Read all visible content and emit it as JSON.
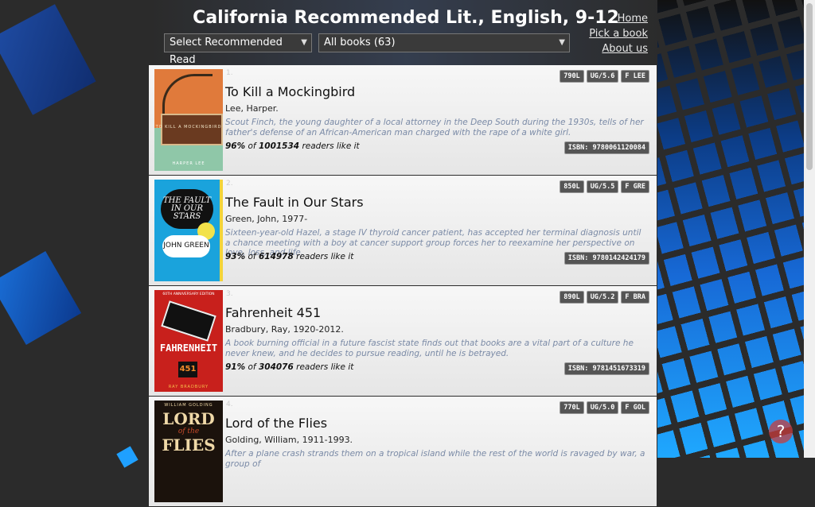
{
  "header": {
    "title": "California Recommended Lit., English, 9-12",
    "select_recommended": "Select Recommended Read",
    "select_books": "All books (63)"
  },
  "nav": {
    "home": "Home",
    "pick": "Pick a book",
    "about": "About us"
  },
  "books": [
    {
      "index": "1.",
      "title": "To Kill a Mockingbird",
      "author": "Lee, Harper.",
      "description": "Scout Finch, the young daughter of a local attorney in the Deep South during the 1930s, tells of her father's defense of an African-American man charged with the rape of a white girl.",
      "percent": "96%",
      "of": "of",
      "readers": "1001534",
      "like": "readers like it",
      "badges": [
        "790L",
        "UG/5.6",
        "F LEE"
      ],
      "isbn": "ISBN: 9780061120084",
      "cover": {
        "title": "TO KILL A MOCKINGBIRD",
        "author": "HARPER LEE"
      }
    },
    {
      "index": "2.",
      "title": "The Fault in Our Stars",
      "author": "Green, John, 1977-",
      "description": "Sixteen-year-old Hazel, a stage IV thyroid cancer patient, has accepted her terminal diagnosis until a chance meeting with a boy at cancer support group forces her to reexamine her perspective on love, loss, and life.",
      "percent": "93%",
      "of": "of",
      "readers": "614978",
      "like": "readers like it",
      "badges": [
        "850L",
        "UG/5.5",
        "F GRE"
      ],
      "isbn": "ISBN: 9780142424179",
      "cover": {
        "title": "THE FAULT IN OUR STARS",
        "author": "JOHN GREEN"
      }
    },
    {
      "index": "3.",
      "title": "Fahrenheit 451",
      "author": "Bradbury, Ray, 1920-2012.",
      "description": "A book burning official in a future fascist state finds out that books are a vital part of a culture he never knew, and he decides to pursue reading, until he is betrayed.",
      "percent": "91%",
      "of": "of",
      "readers": "304076",
      "like": "readers like it",
      "badges": [
        "890L",
        "UG/5.2",
        "F BRA"
      ],
      "isbn": "ISBN: 9781451673319",
      "cover": {
        "edition": "60TH ANNIVERSARY EDITION",
        "title": "FAHRENHEIT",
        "number": "451",
        "author": "RAY BRADBURY"
      }
    },
    {
      "index": "4.",
      "title": "Lord of the Flies",
      "author": "Golding, William, 1911-1993.",
      "description": "After a plane crash strands them on a tropical island while the rest of the world is ravaged by war, a group of",
      "badges": [
        "770L",
        "UG/5.0",
        "F GOL"
      ],
      "cover": {
        "author": "WILLIAM GOLDING",
        "title1": "LORD",
        "title2": "of the",
        "title3": "FLIES"
      }
    }
  ],
  "help": "?",
  "icons": [
    "chevron-down-icon",
    "help-icon"
  ]
}
